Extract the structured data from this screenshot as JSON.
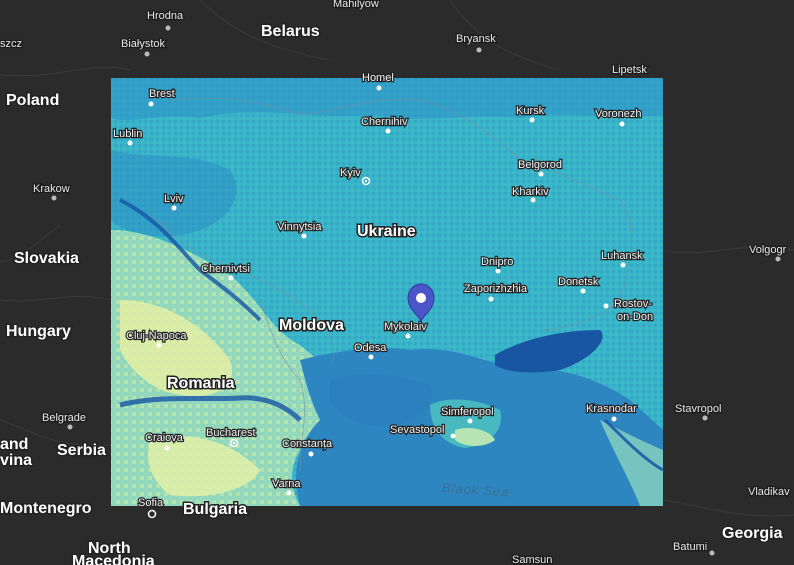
{
  "map": {
    "overlay_colors": {
      "base": "#38b6c8",
      "deep": "#1f74b8",
      "mid": "#43bcc4",
      "light": "#8fd8bf",
      "pale": "#e6f1a8",
      "sea": "#2e86c1",
      "dark_sea": "#1855a2",
      "basemap": "#2b2b2b",
      "pin": "#4a55c8"
    },
    "marker": {
      "icon": "map-pin-icon",
      "color": "#4a55c8"
    },
    "countries_outside": [
      {
        "id": "belarus",
        "name": "Belarus"
      },
      {
        "id": "poland",
        "name": "Poland"
      },
      {
        "id": "slovakia",
        "name": "Slovakia"
      },
      {
        "id": "hungary",
        "name": "Hungary"
      },
      {
        "id": "serbia",
        "name": "Serbia"
      },
      {
        "id": "bulgaria",
        "name": "Bulgaria"
      },
      {
        "id": "georgia",
        "name": "Georgia"
      },
      {
        "id": "north-macedonia-1",
        "name": "North"
      },
      {
        "id": "north-macedonia-2",
        "name": "Macedonia"
      },
      {
        "id": "montenegro",
        "name": "Montenegro"
      },
      {
        "id": "bosnia-1",
        "name": "and"
      },
      {
        "id": "bosnia-2",
        "name": "vina"
      }
    ],
    "cities_outside": [
      {
        "id": "hrodna",
        "name": "Hrodna"
      },
      {
        "id": "mahilyow",
        "name": "Mahilyow"
      },
      {
        "id": "szcz",
        "name": "szcz"
      },
      {
        "id": "bialystok",
        "name": "Białystok"
      },
      {
        "id": "bryansk",
        "name": "Bryansk"
      },
      {
        "id": "lipetsk",
        "name": "Lipetsk"
      },
      {
        "id": "krakow",
        "name": "Krakow"
      },
      {
        "id": "volgograd",
        "name": "Volgogr"
      },
      {
        "id": "belgrade",
        "name": "Belgrade"
      },
      {
        "id": "stavropol",
        "name": "Stavropol"
      },
      {
        "id": "vladikavkaz",
        "name": "Vladikav"
      },
      {
        "id": "batumi",
        "name": "Batumi"
      },
      {
        "id": "samsun",
        "name": "Samsun"
      }
    ],
    "overlay_labels": [
      {
        "id": "ukraine",
        "name": "Ukraine",
        "cls": "country"
      },
      {
        "id": "moldova",
        "name": "Moldova",
        "cls": "country"
      },
      {
        "id": "romania",
        "name": "Romania",
        "cls": "country"
      }
    ],
    "overlay_cities": [
      {
        "id": "homel",
        "name": "Homel"
      },
      {
        "id": "brest",
        "name": "Brest"
      },
      {
        "id": "lublin",
        "name": "Lublin"
      },
      {
        "id": "chernihiv",
        "name": "Chernihiv"
      },
      {
        "id": "kursk",
        "name": "Kursk"
      },
      {
        "id": "voronezh",
        "name": "Voronezh"
      },
      {
        "id": "kyiv",
        "name": "Kyiv"
      },
      {
        "id": "belgorod",
        "name": "Belgorod"
      },
      {
        "id": "kharkiv",
        "name": "Kharkiv"
      },
      {
        "id": "lviv",
        "name": "Lviv"
      },
      {
        "id": "vinnytsia",
        "name": "Vinnytsia"
      },
      {
        "id": "chernivtsi",
        "name": "Chernivtsi"
      },
      {
        "id": "dnipro",
        "name": "Dnipro"
      },
      {
        "id": "luhansk",
        "name": "Luhansk"
      },
      {
        "id": "zaporizhzhia",
        "name": "Zaporizhzhia"
      },
      {
        "id": "donetsk",
        "name": "Donetsk"
      },
      {
        "id": "rostov-1",
        "name": "Rostov-"
      },
      {
        "id": "rostov-2",
        "name": "on-Don"
      },
      {
        "id": "cluj",
        "name": "Cluj-Napoca"
      },
      {
        "id": "mykolaiv",
        "name": "Mykolaiv"
      },
      {
        "id": "odesa",
        "name": "Odesa"
      },
      {
        "id": "simferopol",
        "name": "Simferopol"
      },
      {
        "id": "krasnodar",
        "name": "Krasnodar"
      },
      {
        "id": "sevastopol",
        "name": "Sevastopol"
      },
      {
        "id": "craiova",
        "name": "Craiova"
      },
      {
        "id": "bucharest",
        "name": "Bucharest"
      },
      {
        "id": "constanta",
        "name": "Constanța"
      },
      {
        "id": "varna",
        "name": "Varna"
      },
      {
        "id": "sofia",
        "name": "Sofia"
      }
    ],
    "sea_label": "Black Sea"
  }
}
